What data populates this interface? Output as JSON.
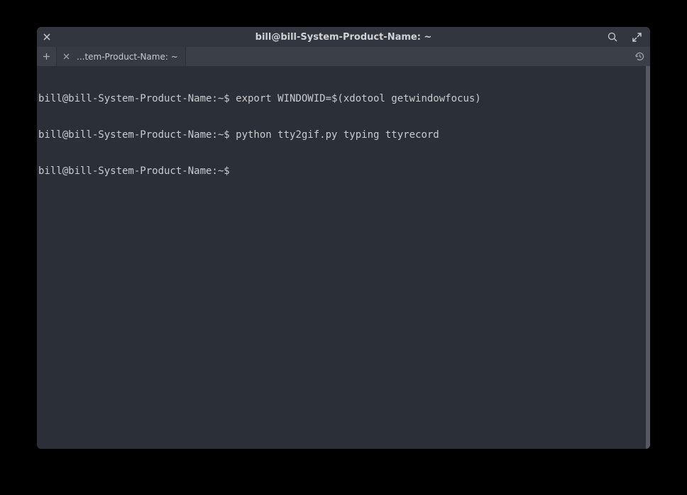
{
  "titlebar": {
    "title": "bill@bill-System-Product-Name: ~"
  },
  "tabs": [
    {
      "label": "...tem-Product-Name: ~"
    }
  ],
  "terminal": {
    "lines": [
      {
        "prompt": "bill@bill-System-Product-Name:~$",
        "command": " export WINDOWID=$(xdotool getwindowfocus)"
      },
      {
        "prompt": "bill@bill-System-Product-Name:~$",
        "command": " python tty2gif.py typing ttyrecord"
      },
      {
        "prompt": "bill@bill-System-Product-Name:~$",
        "command": ""
      }
    ]
  }
}
